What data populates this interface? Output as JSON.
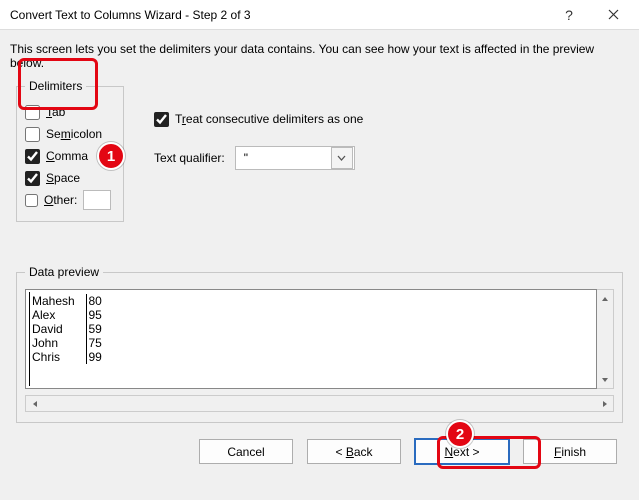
{
  "window": {
    "title": "Convert Text to Columns Wizard - Step 2 of 3"
  },
  "description": "This screen lets you set the delimiters your data contains.  You can see how your text is affected in the preview below.",
  "group_labels": {
    "delimiters": "Delimiters",
    "preview": "Data preview"
  },
  "delimiters": {
    "tab": {
      "label": "Tab",
      "accel": "T",
      "checked": false
    },
    "semicolon": {
      "label": "Semicolon",
      "accel": "S",
      "checked": false
    },
    "comma": {
      "label": "Comma",
      "accel": "C",
      "checked": true
    },
    "space": {
      "label": "Space",
      "accel": "S",
      "checked": true
    },
    "other": {
      "label": "Other:",
      "accel": "O",
      "checked": false,
      "value": ""
    }
  },
  "options": {
    "treat_consecutive": {
      "label": "Treat consecutive delimiters as one",
      "accel": "r",
      "checked": true
    },
    "qualifier_label": "Text qualifier:",
    "qualifier_value": "\""
  },
  "preview_rows": [
    {
      "c0": "Mahesh",
      "c1": "80"
    },
    {
      "c0": "Alex",
      "c1": "95"
    },
    {
      "c0": "David",
      "c1": "59"
    },
    {
      "c0": "John",
      "c1": "75"
    },
    {
      "c0": "Chris",
      "c1": "99"
    }
  ],
  "buttons": {
    "cancel": "Cancel",
    "back": "< Back",
    "next": "Next >",
    "finish": "Finish"
  },
  "annotations": {
    "badge1": "1",
    "badge2": "2"
  }
}
